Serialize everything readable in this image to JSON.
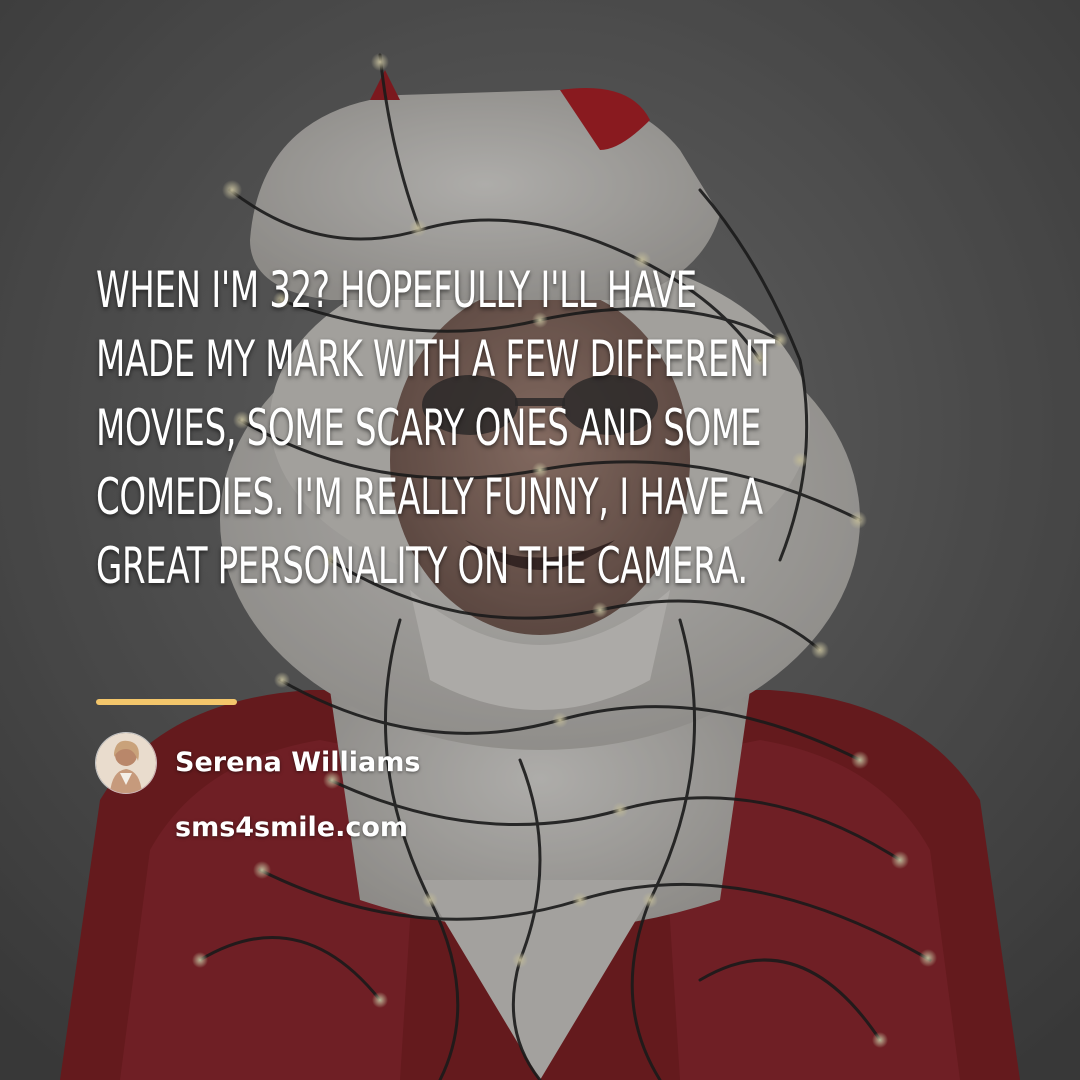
{
  "quote": {
    "lines": [
      "WHEN I'M 32? HOPEFULLY I'LL HAVE",
      "MADE MY MARK WITH A FEW DIFFERENT",
      "MOVIES, SOME SCARY ONES AND SOME",
      "COMEDIES. I'M REALLY FUNNY, I HAVE A",
      "GREAT PERSONALITY ON THE CAMERA."
    ]
  },
  "author": {
    "name": "Serena Williams"
  },
  "site": {
    "url": "sms4smile.com"
  },
  "colors": {
    "accent_line": "#f3c66b",
    "text": "#ffffff",
    "background": "#5a5a5a",
    "santa_red": "#8e1a1d",
    "fur_white": "#e4e2de"
  },
  "background_image": {
    "subject": "person in santa hat and santa suit wrapped in string lights",
    "icon": "photo-background"
  }
}
